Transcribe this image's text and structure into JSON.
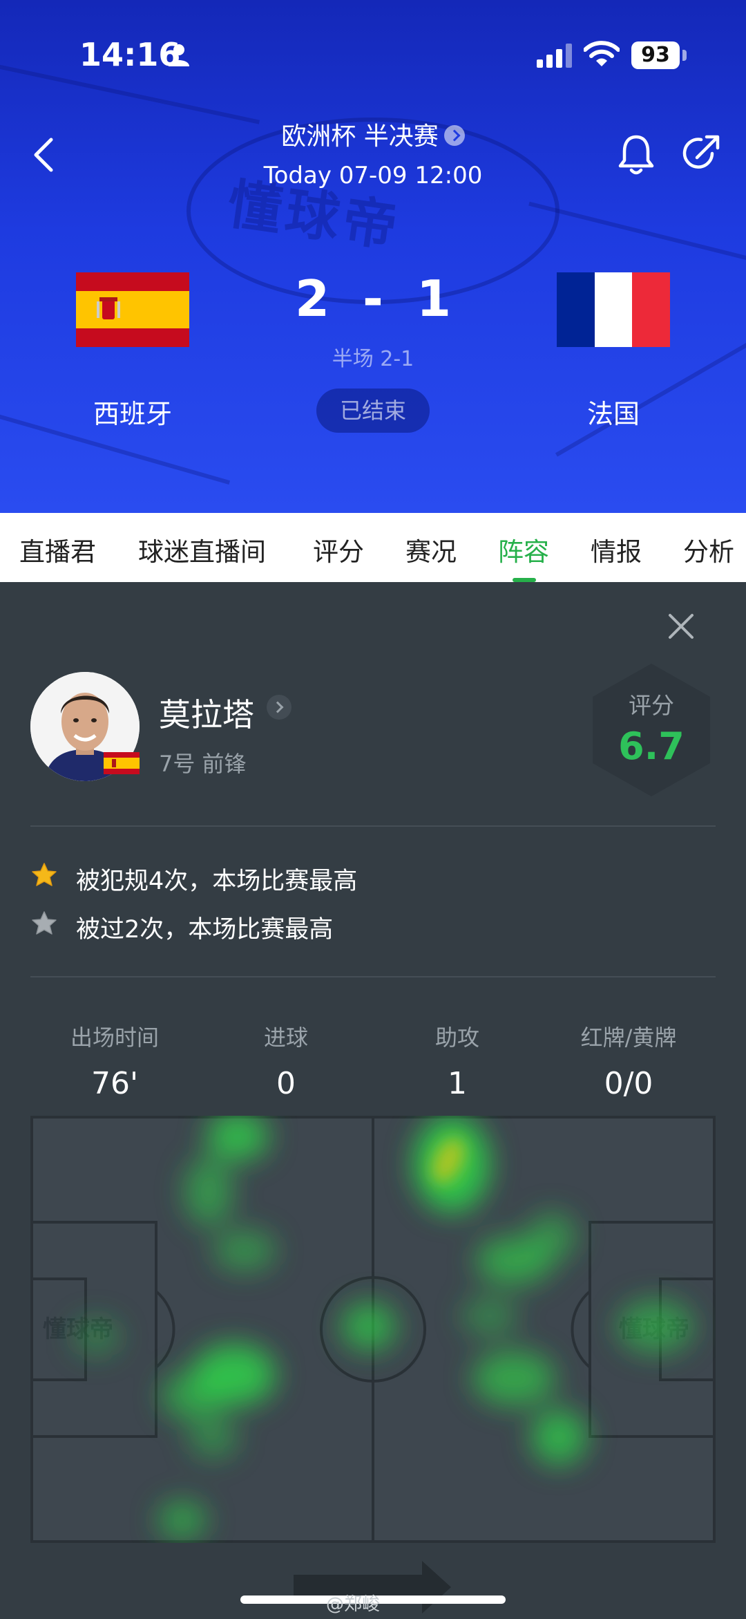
{
  "status_bar": {
    "time": "14:16",
    "battery": "93"
  },
  "header": {
    "competition": "欧洲杯 半决赛",
    "datetime": "Today 07-09 12:00",
    "home_team": "西班牙",
    "away_team": "法国",
    "home_score": "2",
    "away_score": "1",
    "score_separator": "-",
    "halftime": "半场 2-1",
    "match_status": "已结束",
    "watermark": "懂球帝",
    "home_flag_colors": [
      "#c60b1e",
      "#ffc400"
    ],
    "away_flag_colors": [
      "#002395",
      "#ffffff",
      "#ed2939"
    ]
  },
  "tabs": [
    "直播君",
    "球迷直播间",
    "评分",
    "赛况",
    "阵容",
    "情报",
    "分析"
  ],
  "active_tab": "阵容",
  "player": {
    "name": "莫拉塔",
    "meta": "7号 前锋",
    "rating_label": "评分",
    "rating": "6.7"
  },
  "highlights": [
    {
      "icon": "gold-star-icon",
      "text": "被犯规4次，本场比赛最高"
    },
    {
      "icon": "silver-star-icon",
      "text": "被过2次，本场比赛最高"
    }
  ],
  "stats": [
    {
      "label": "出场时间",
      "value": "76'"
    },
    {
      "label": "进球",
      "value": "0"
    },
    {
      "label": "助攻",
      "value": "1"
    },
    {
      "label": "红牌/黄牌",
      "value": "0/0"
    }
  ],
  "pitch_watermark": "懂球帝",
  "credit": "@郑峻",
  "colors": {
    "accent_green": "#26b04a",
    "rating_green": "#2ec15a",
    "header_blue": "#1e3be0",
    "panel_bg": "#343d44"
  }
}
